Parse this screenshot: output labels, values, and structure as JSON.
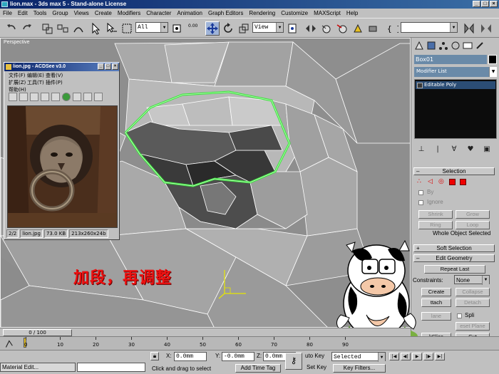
{
  "window": {
    "title": "lion.max - 3ds max 5 - Stand-alone License"
  },
  "menu": [
    "File",
    "Edit",
    "Tools",
    "Group",
    "Views",
    "Create",
    "Modifiers",
    "Character",
    "Animation",
    "Graph Editors",
    "Rendering",
    "Customize",
    "MAXScript",
    "Help"
  ],
  "toolbar": {
    "selection_filter": "All",
    "spinner_value": "0.00",
    "reference_coord": "View",
    "active_tool": "select-and-move"
  },
  "viewport": {
    "label": "Perspective",
    "annotation": "加段，再调整"
  },
  "acdsee": {
    "title": "lion.jpg - ACDSee v3.0",
    "menu": [
      "文件(F)",
      "编辑(E)",
      "查看(V)",
      "扩展(Z)",
      "工具(T)",
      "插件(P)",
      "帮助(H)"
    ],
    "status": {
      "index": "2/2",
      "filename": "lion.jpg",
      "size": "73.0 KB",
      "dims": "213x260x24b"
    }
  },
  "command_panel": {
    "object_name": "Box01",
    "modifier_list": "Modifier List",
    "stack_item": "Editable Poly",
    "selection": {
      "title": "Selection",
      "by_label": "By",
      "ignore_label": "Ignore",
      "shrink": "Shrink",
      "grow": "Grow",
      "ring": "Ring",
      "loop": "Loop",
      "status": "Whole Object Selected"
    },
    "soft_selection": "Soft Selection",
    "edit_geometry": {
      "title": "Edit Geometry",
      "repeat_last": "Repeat Last",
      "constraints_label": "Constraints:",
      "constraints_value": "None",
      "create": "Create",
      "collapse": "Collapse",
      "attach": "ttach",
      "detach": "Detach",
      "slice_plane": "lane",
      "split": "Spli",
      "reset_plane": "eset Plane",
      "quickslice": "kSlice",
      "cut": "Cut"
    }
  },
  "timeline": {
    "frame": "0 / 100",
    "ticks": [
      "0",
      "10",
      "20",
      "30",
      "40",
      "50",
      "60",
      "70",
      "80",
      "90"
    ]
  },
  "status_bar": {
    "x_label": "X:",
    "x_value": "0.0mm",
    "y_label": "Y:",
    "y_value": "-0.0mm",
    "z_label": "Z:",
    "z_value": "0.0mm",
    "prompt": "Click and drag to select",
    "add_time_tag": "Add Time Tag",
    "auto_key": "uto Key",
    "set_key": "Set Key",
    "selected": "Selected",
    "key_filters": "Key Filters...",
    "mini_listener": "Material Edit..."
  },
  "colors": {
    "selection_edges": "#3fe23f",
    "annotation": "#e81818",
    "title_bar": "#0a246a"
  }
}
